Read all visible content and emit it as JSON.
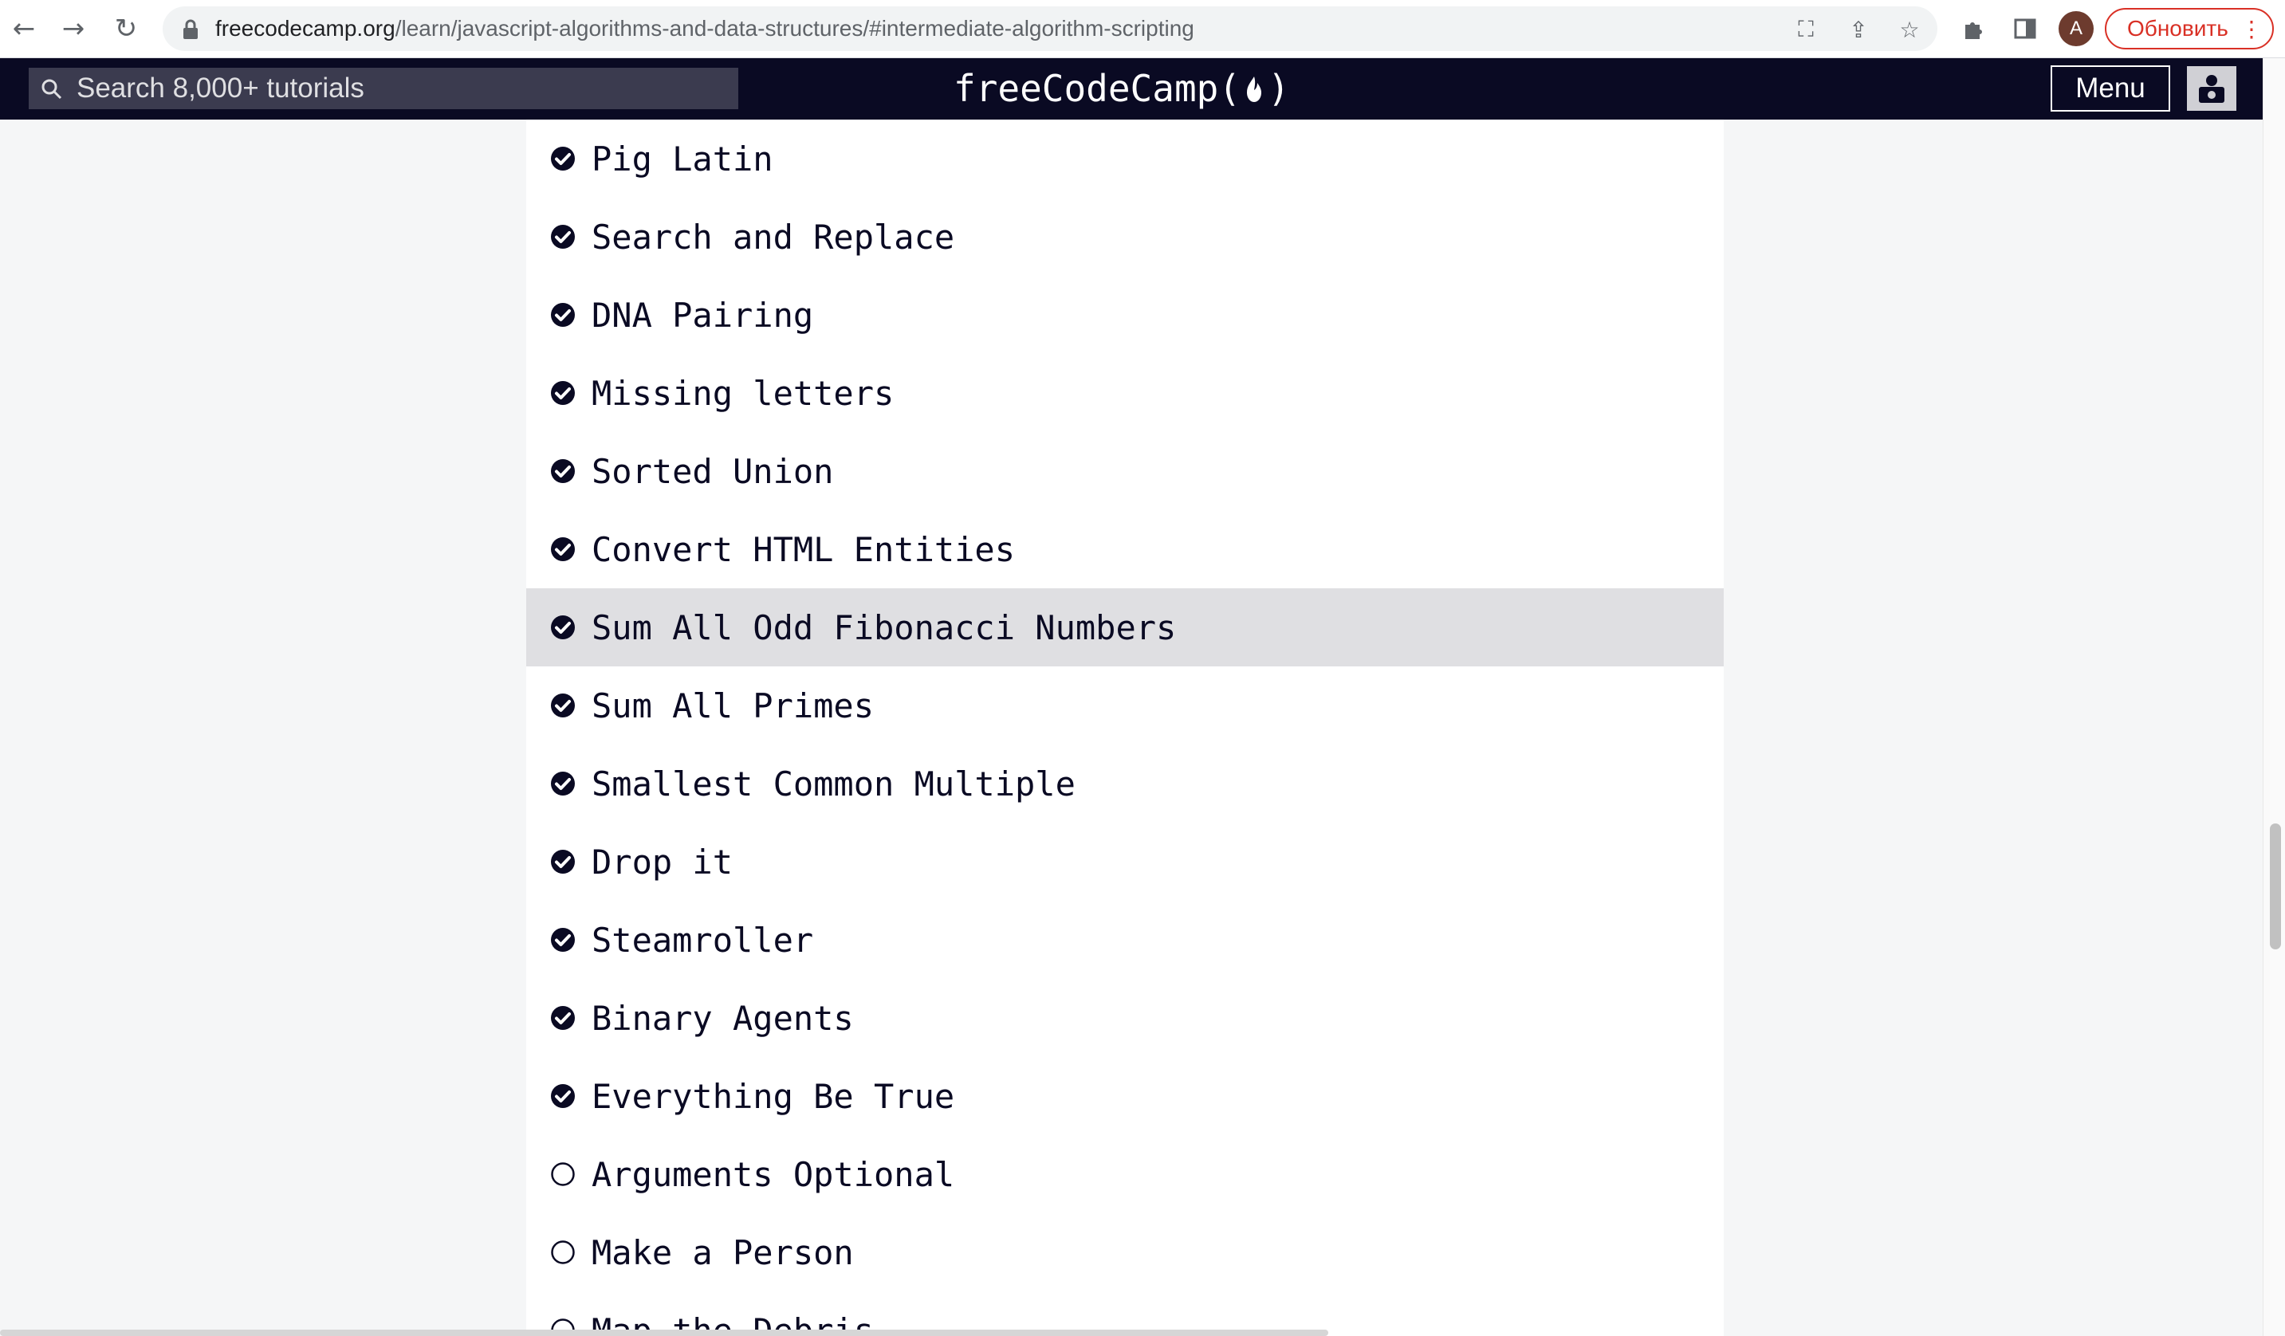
{
  "browser": {
    "url_host": "freecodecamp.org",
    "url_path": "/learn/javascript-algorithms-and-data-structures/#intermediate-algorithm-scripting",
    "update_label": "Обновить",
    "profile_initial": "A",
    "icons": {
      "back": "arrow-left-icon",
      "forward": "arrow-right-icon",
      "reload": "reload-icon",
      "lock": "lock-icon",
      "translate": "translate-icon",
      "share": "share-icon",
      "bookmark": "star-icon",
      "extensions": "puzzle-icon",
      "sidepanel": "side-panel-icon",
      "more": "kebab-menu-icon"
    }
  },
  "header": {
    "search_placeholder": "Search 8,000+ tutorials",
    "logo_text_left": "freeCodeCamp(",
    "logo_text_right": ")",
    "menu_label": "Menu"
  },
  "challenges": [
    {
      "label": "Pig Latin",
      "completed": true
    },
    {
      "label": "Search and Replace",
      "completed": true
    },
    {
      "label": "DNA Pairing",
      "completed": true
    },
    {
      "label": "Missing letters",
      "completed": true
    },
    {
      "label": "Sorted Union",
      "completed": true
    },
    {
      "label": "Convert HTML Entities",
      "completed": true
    },
    {
      "label": "Sum All Odd Fibonacci Numbers",
      "completed": true,
      "hovered": true
    },
    {
      "label": "Sum All Primes",
      "completed": true
    },
    {
      "label": "Smallest Common Multiple",
      "completed": true
    },
    {
      "label": "Drop it",
      "completed": true
    },
    {
      "label": "Steamroller",
      "completed": true
    },
    {
      "label": "Binary Agents",
      "completed": true
    },
    {
      "label": "Everything Be True",
      "completed": true
    },
    {
      "label": "Arguments Optional",
      "completed": false
    },
    {
      "label": "Make a Person",
      "completed": false
    },
    {
      "label": "Map the Debris",
      "completed": false
    }
  ],
  "colors": {
    "nav_bg": "#0a0a23",
    "search_bg": "#3b3b4f",
    "page_bg": "#f5f6f7",
    "hover_bg": "#dfdfe2",
    "text": "#0a0a23",
    "update_red": "#d93025"
  }
}
